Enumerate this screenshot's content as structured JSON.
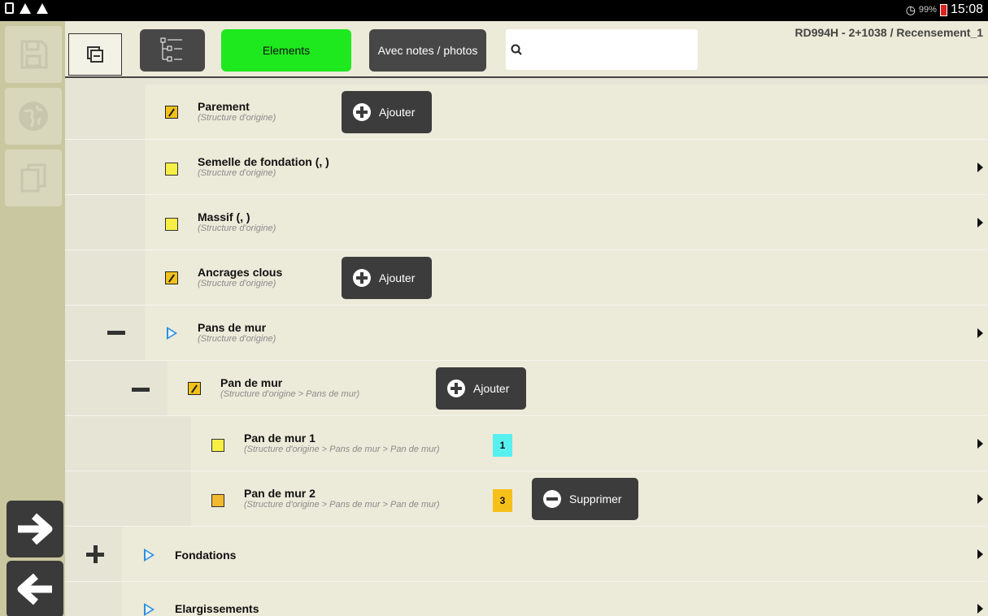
{
  "status_bar": {
    "battery_pct": "99%",
    "time": "15:08"
  },
  "toolbar": {
    "elements_label": "Elements",
    "notes_label": "Avec notes / photos",
    "search_placeholder": "",
    "breadcrumb": "RD994H - 2+1038 / Recensement_1"
  },
  "rows": [
    {
      "title": "Parement",
      "subtitle": "(Structure d'origine)",
      "button": "Ajouter"
    },
    {
      "title": "Semelle de fondation (, )",
      "subtitle": "(Structure d'origine)"
    },
    {
      "title": "Massif (, )",
      "subtitle": "(Structure d'origine)"
    },
    {
      "title": "Ancrages clous",
      "subtitle": "(Structure d'origine)",
      "button": "Ajouter"
    },
    {
      "title": "Pans de mur",
      "subtitle": "(Structure d'origine)"
    },
    {
      "title": "Pan de mur",
      "subtitle": "(Structure d'origine > Pans de mur)",
      "button": "Ajouter"
    },
    {
      "title": "Pan de mur 1",
      "subtitle": "(Structure d'origine > Pans de mur > Pan de mur)",
      "badge": "1",
      "badge_color": "#58f0ef"
    },
    {
      "title": "Pan de mur 2",
      "subtitle": "(Structure d'origine > Pans de mur > Pan de mur)",
      "badge": "3",
      "badge_color": "#f6c01a",
      "button": "Supprimer"
    },
    {
      "title": "Fondations"
    },
    {
      "title": "Elargissements"
    }
  ],
  "colors": {
    "elements_accent": "#1ee81e",
    "badge_cyan": "#58f0ef",
    "badge_orange": "#f6c01a"
  }
}
